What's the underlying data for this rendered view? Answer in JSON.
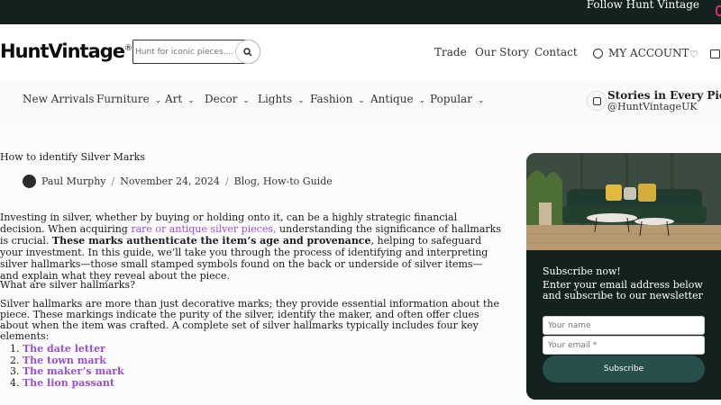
{
  "topbar": {
    "follow_text": "Follow Hunt Vintage",
    "instagram_icon": "instagram-icon"
  },
  "header": {
    "logo": "HuntVintage",
    "logo_mark": "®",
    "search_placeholder": "Hunt for iconic pieces....",
    "nav": [
      "Trade",
      "Our Story",
      "Contact"
    ],
    "account": "MY ACCOUNT",
    "icons": [
      "user-icon",
      "heart-icon",
      "bag-icon"
    ]
  },
  "menu": {
    "items": [
      {
        "label": "New Arrivals",
        "dropdown": false
      },
      {
        "label": "Furniture",
        "dropdown": true
      },
      {
        "label": "Art",
        "dropdown": true
      },
      {
        "label": "Decor",
        "dropdown": true
      },
      {
        "label": "Lights",
        "dropdown": true
      },
      {
        "label": "Fashion",
        "dropdown": true
      },
      {
        "label": "Antique",
        "dropdown": true
      },
      {
        "label": "Popular",
        "dropdown": true
      }
    ],
    "chevron": "⌄",
    "stories_title": "Stories in Every Piece.",
    "stories_handle": "@HuntVintageUK"
  },
  "article": {
    "title": "How to identify Silver Marks",
    "author": "Paul Murphy",
    "date": "November 24, 2024",
    "categories": "Blog, How-to Guide",
    "sep": "/",
    "intro_1": "Investing in silver, whether by buying or holding onto it, can be a highly strategic financial decision. When acquiring ",
    "intro_link": "rare or antique silver pieces,",
    "intro_2": " understanding the significance of hallmarks is crucial. ",
    "intro_bold": "These marks authenticate the item’s age and provenance",
    "intro_3": ", helping to safeguard your investment. In this guide, we’ll take you through the process of identifying and interpreting silver hallmarks—those small stamped symbols found on the back or underside of silver items—and explain what they reveal about the piece.",
    "section_heading": "What are silver hallmarks?",
    "section_text": "Silver hallmarks are more than just decorative marks; they provide essential information about the piece. These markings indicate the purity of the silver, identify the maker, and often offer clues about when the item was crafted. A complete set of silver hallmarks typically includes four key elements:",
    "list": [
      "The date letter",
      "The town mark",
      "The maker’s mark",
      "The lion passant"
    ]
  },
  "newsletter": {
    "title": "Subscribe now!",
    "text": "Enter your email address below and subscribe to our newsletter",
    "name_placeholder": "Your name",
    "email_placeholder": "Your email *",
    "button": "Subscribe"
  },
  "colors": {
    "dark": "#13221e",
    "accent": "#9a4fd0",
    "button": "#274f4c"
  }
}
